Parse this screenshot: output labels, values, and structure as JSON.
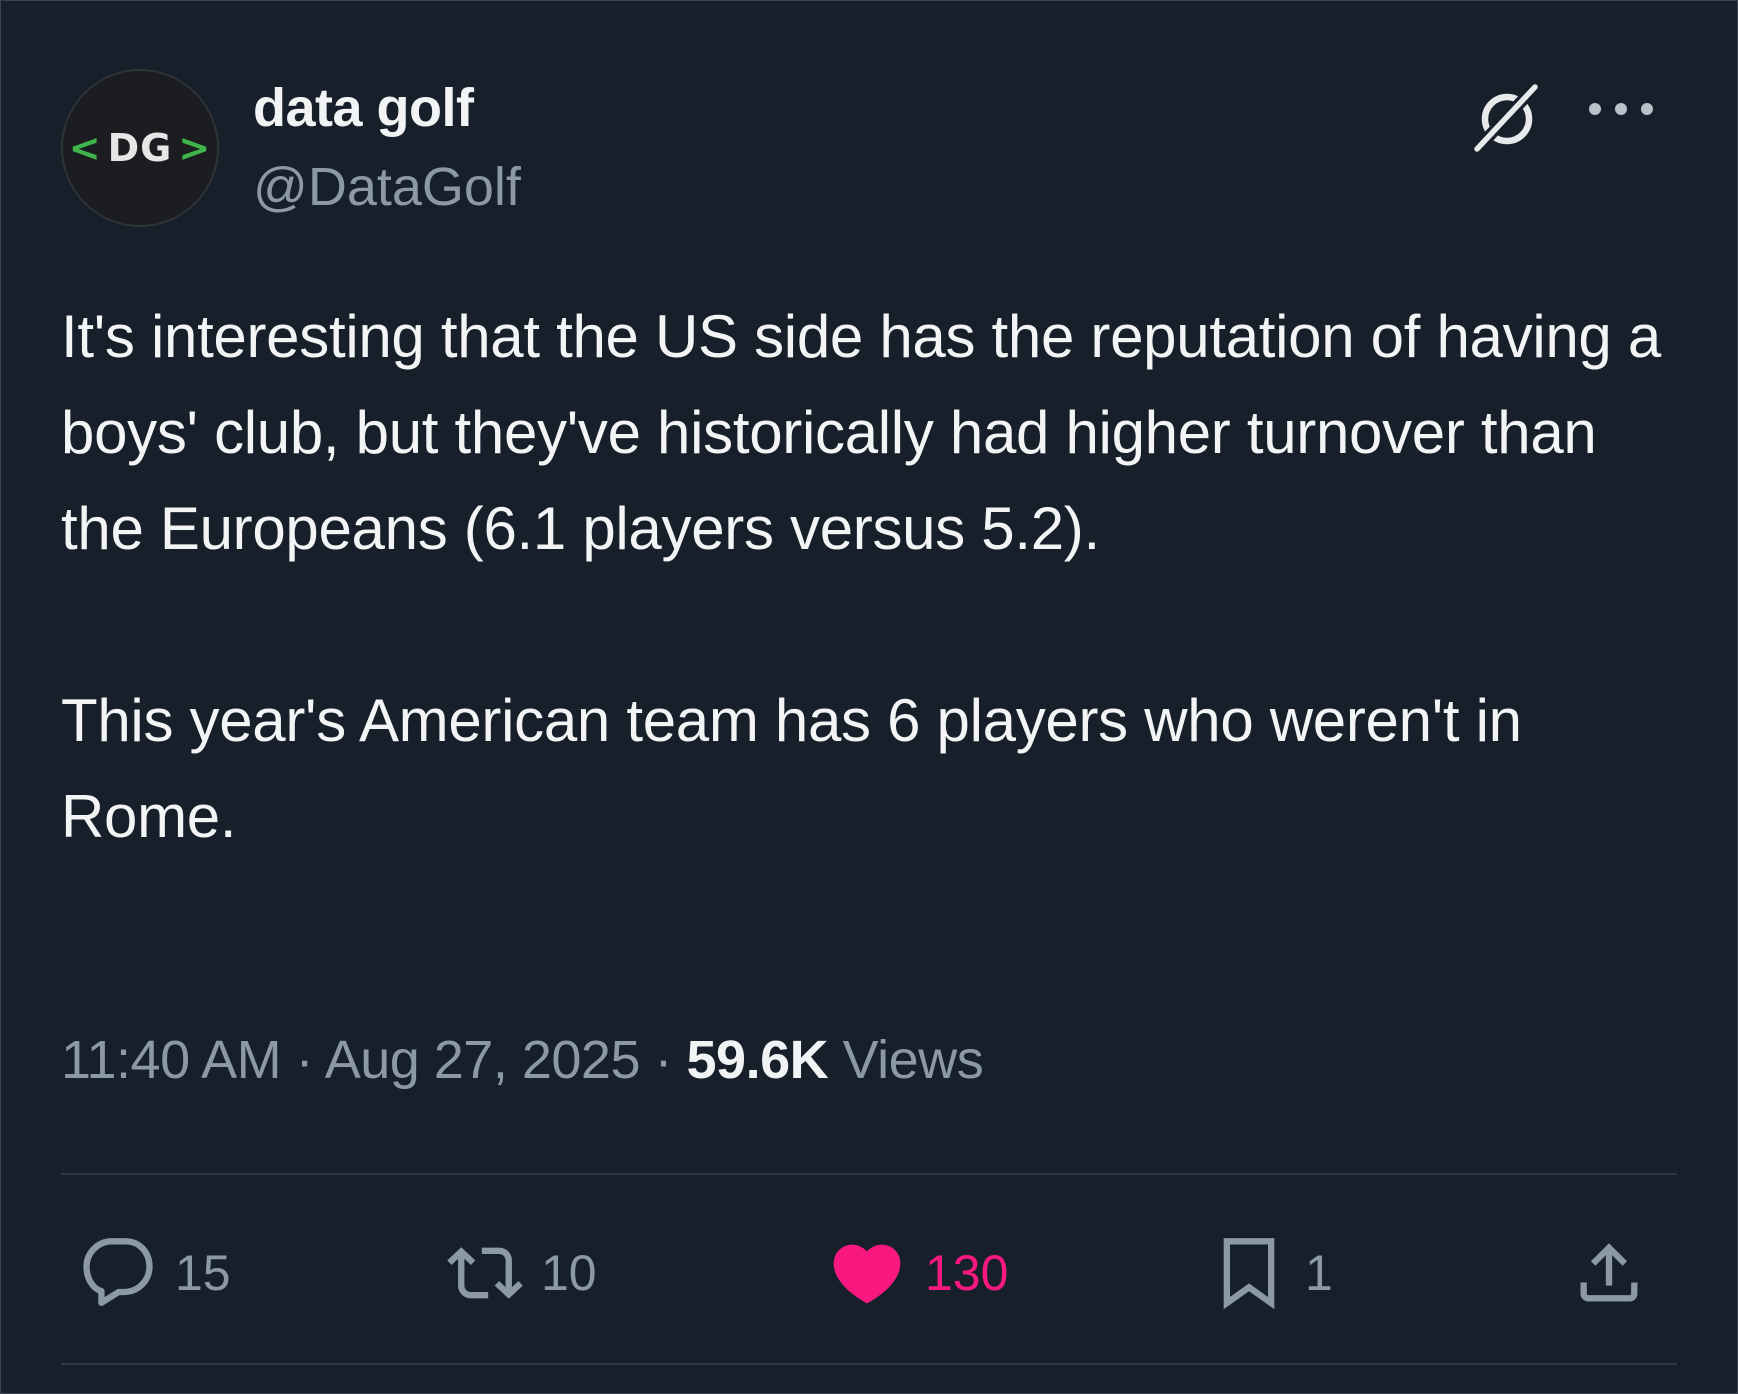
{
  "author": {
    "display_name": "data golf",
    "handle": "@DataGolf",
    "avatar": {
      "left_bracket": "<",
      "initials": "DG",
      "right_bracket": ">",
      "bracket_color": "#3fb44b"
    }
  },
  "header_icons": {
    "grok": "grok-icon",
    "more": "more-icon"
  },
  "tweet": {
    "paragraphs": [
      "It's interesting that the US side has the reputation of having a boys' club, but they've historically had higher turnover than the Europeans (6.1 players versus 5.2).",
      "This year's American team has 6 players who weren't in Rome."
    ]
  },
  "meta": {
    "time": "11:40 AM",
    "separator": "·",
    "date": "Aug 27, 2025",
    "views_count": "59.6K",
    "views_label": "Views"
  },
  "actions": {
    "reply": {
      "icon": "reply-icon",
      "count": "15"
    },
    "repost": {
      "icon": "repost-icon",
      "count": "10"
    },
    "like": {
      "icon": "heart-icon",
      "count": "130",
      "liked": true,
      "color": "#f91880"
    },
    "bookmark": {
      "icon": "bookmark-icon",
      "count": "1"
    },
    "share": {
      "icon": "share-icon"
    }
  },
  "colors": {
    "background": "#171f2a",
    "text": "#f2f4f5",
    "secondary": "#8b98a5",
    "like": "#f91880"
  }
}
